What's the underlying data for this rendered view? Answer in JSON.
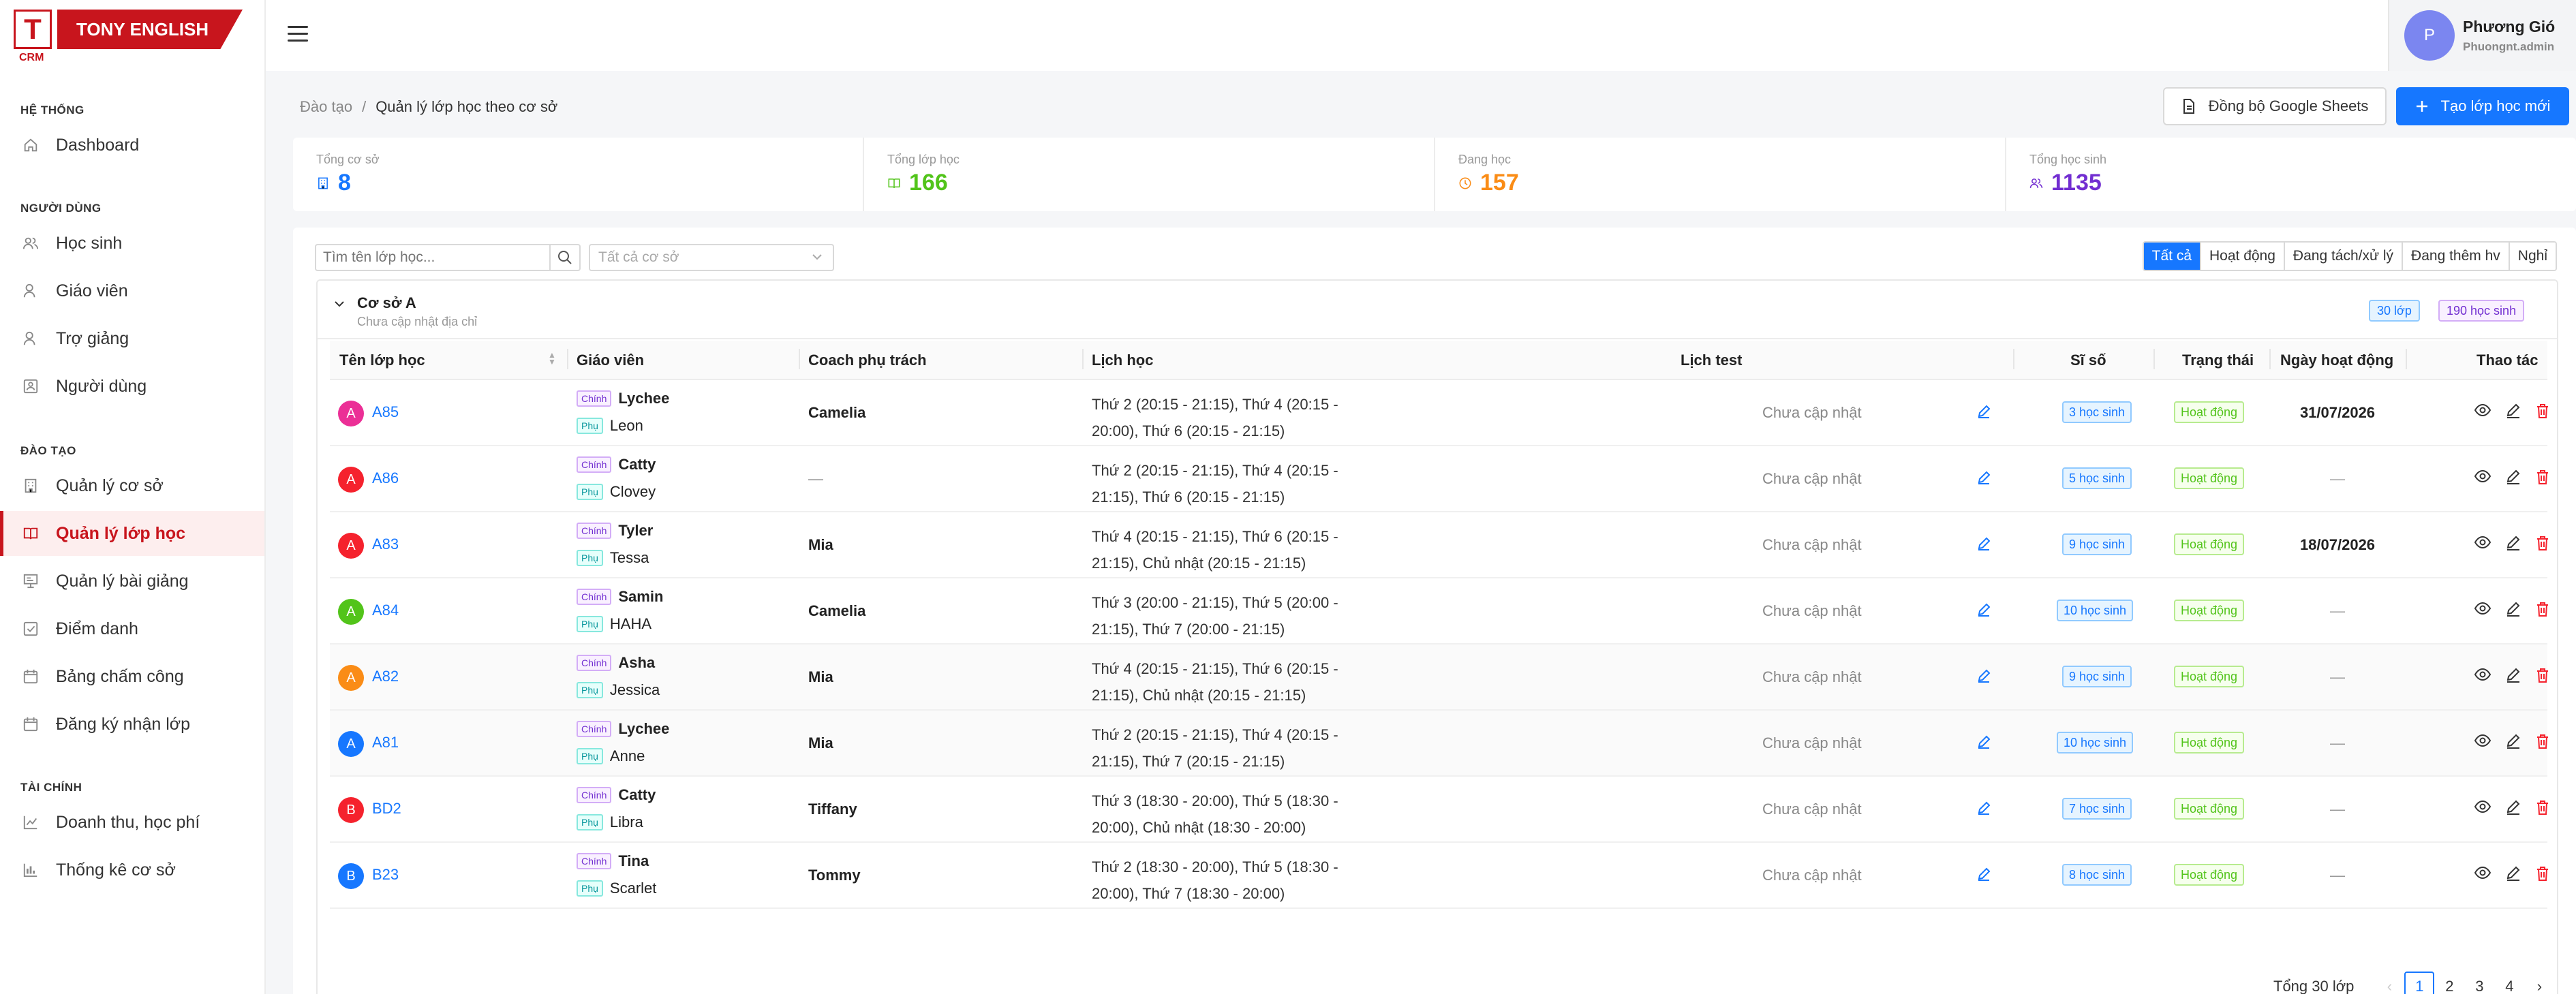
{
  "brand": {
    "letter": "T",
    "name": "TONY ENGLISH",
    "sub": "CRM",
    "color": "#c8151d"
  },
  "sidebar": {
    "sections": [
      {
        "title": "HỆ THỐNG",
        "items": [
          {
            "label": "Dashboard",
            "icon": "home-icon"
          }
        ]
      },
      {
        "title": "NGƯỜI DÙNG",
        "items": [
          {
            "label": "Học sinh",
            "icon": "users-icon"
          },
          {
            "label": "Giáo viên",
            "icon": "user-icon"
          },
          {
            "label": "Trợ giảng",
            "icon": "user-icon"
          },
          {
            "label": "Người dùng",
            "icon": "id-card-icon"
          }
        ]
      },
      {
        "title": "ĐÀO TẠO",
        "items": [
          {
            "label": "Quản lý cơ sở",
            "icon": "building-icon"
          },
          {
            "label": "Quản lý lớp học",
            "icon": "book-icon",
            "active": true
          },
          {
            "label": "Quản lý bài giảng",
            "icon": "presentation-icon"
          },
          {
            "label": "Điểm danh",
            "icon": "checkbox-icon"
          },
          {
            "label": "Bảng chấm công",
            "icon": "calendar-icon"
          },
          {
            "label": "Đăng ký nhận lớp",
            "icon": "calendar-icon"
          }
        ]
      },
      {
        "title": "TÀI CHÍNH",
        "items": [
          {
            "label": "Doanh thu, học phí",
            "icon": "chart-icon"
          },
          {
            "label": "Thống kê cơ sở",
            "icon": "bar-chart-icon"
          }
        ]
      }
    ]
  },
  "user": {
    "avatar_letter": "P",
    "name": "Phương Gió",
    "username": "Phuongnt.admin"
  },
  "breadcrumb": {
    "parent": "Đào tạo",
    "separator": "/",
    "current": "Quản lý lớp học theo cơ sở"
  },
  "actions": {
    "sync_label": "Đồng bộ Google Sheets",
    "create_label": "Tạo lớp học mới"
  },
  "stats": [
    {
      "label": "Tổng cơ sở",
      "value": "8",
      "color": "#1677ff",
      "icon": "building-icon"
    },
    {
      "label": "Tổng lớp học",
      "value": "166",
      "color": "#52c41a",
      "icon": "book-icon"
    },
    {
      "label": "Đang học",
      "value": "157",
      "color": "#fa8c16",
      "icon": "clock-icon"
    },
    {
      "label": "Tổng học sinh",
      "value": "1135",
      "color": "#722ed1",
      "icon": "users-icon"
    }
  ],
  "search": {
    "placeholder": "Tìm tên lớp học..."
  },
  "branch_select": {
    "placeholder": "Tất cả cơ sở"
  },
  "filters": [
    {
      "label": "Tất cả",
      "active": true
    },
    {
      "label": "Hoạt động"
    },
    {
      "label": "Đang tách/xử lý"
    },
    {
      "label": "Đang thêm hv"
    },
    {
      "label": "Nghỉ"
    }
  ],
  "group": {
    "title": "Cơ sở A",
    "subtitle": "Chưa cập nhật địa chỉ",
    "class_count": "30 lớp",
    "student_count": "190 học sinh"
  },
  "columns": {
    "name": "Tên lớp học",
    "teacher": "Giáo viên",
    "coach": "Coach phụ trách",
    "schedule": "Lịch học",
    "test": "Lịch test",
    "size": "Sĩ số",
    "status": "Trạng thái",
    "active_date": "Ngày hoạt động",
    "actions": "Thao tác"
  },
  "roles": {
    "main": "Chính",
    "sub": "Phụ"
  },
  "rows": [
    {
      "letter": "A",
      "color": "#eb2f96",
      "name": "A85",
      "main": "Lychee",
      "sub": "Leon",
      "coach": "Camelia",
      "schedule": "Thứ 2 (20:15 - 21:15), Thứ 4 (20:15 - 20:00), Thứ 6 (20:15 - 21:15)",
      "test": "Chưa cập nhật",
      "size": "3 học sinh",
      "status": "Hoạt động",
      "date": "31/07/2026"
    },
    {
      "letter": "A",
      "color": "#f5222d",
      "name": "A86",
      "main": "Catty",
      "sub": "Clovey",
      "coach": "—",
      "schedule": "Thứ 2 (20:15 - 21:15), Thứ 4 (20:15 - 21:15), Thứ 6 (20:15 - 21:15)",
      "test": "Chưa cập nhật",
      "size": "5 học sinh",
      "status": "Hoạt động",
      "date": "—"
    },
    {
      "letter": "A",
      "color": "#f5222d",
      "name": "A83",
      "main": "Tyler",
      "sub": "Tessa",
      "coach": "Mia",
      "schedule": "Thứ 4 (20:15 - 21:15), Thứ 6 (20:15 - 21:15), Chủ nhật (20:15 - 21:15)",
      "test": "Chưa cập nhật",
      "size": "9 học sinh",
      "status": "Hoạt động",
      "date": "18/07/2026"
    },
    {
      "letter": "A",
      "color": "#52c41a",
      "name": "A84",
      "main": "Samin",
      "sub": "HAHA",
      "coach": "Camelia",
      "schedule": "Thứ 3 (20:00 - 21:15), Thứ 5 (20:00 - 21:15), Thứ 7 (20:00 - 21:15)",
      "test": "Chưa cập nhật",
      "size": "10 học sinh",
      "status": "Hoạt động",
      "date": "—"
    },
    {
      "letter": "A",
      "color": "#fa8c16",
      "name": "A82",
      "main": "Asha",
      "sub": "Jessica",
      "coach": "Mia",
      "schedule": "Thứ 4 (20:15 - 21:15), Thứ 6 (20:15 - 21:15), Chủ nhật (20:15 - 21:15)",
      "test": "Chưa cập nhật",
      "size": "9 học sinh",
      "status": "Hoạt động",
      "date": "—"
    },
    {
      "letter": "A",
      "color": "#1677ff",
      "name": "A81",
      "main": "Lychee",
      "sub": "Anne",
      "coach": "Mia",
      "schedule": "Thứ 2 (20:15 - 21:15), Thứ 4 (20:15 - 21:15), Thứ 7 (20:15 - 21:15)",
      "test": "Chưa cập nhật",
      "size": "10 học sinh",
      "status": "Hoạt động",
      "date": "—"
    },
    {
      "letter": "B",
      "color": "#f5222d",
      "name": "BD2",
      "main": "Catty",
      "sub": "Libra",
      "coach": "Tiffany",
      "schedule": "Thứ 3 (18:30 - 20:00), Thứ 5 (18:30 - 20:00), Chủ nhật (18:30 - 20:00)",
      "test": "Chưa cập nhật",
      "size": "7 học sinh",
      "status": "Hoạt động",
      "date": "—"
    },
    {
      "letter": "B",
      "color": "#1677ff",
      "name": "B23",
      "main": "Tina",
      "sub": "Scarlet",
      "coach": "Tommy",
      "schedule": "Thứ 2 (18:30 - 20:00), Thứ 5 (18:30 - 20:00), Thứ 7 (18:30 - 20:00)",
      "test": "Chưa cập nhật",
      "size": "8 học sinh",
      "status": "Hoạt động",
      "date": "—"
    }
  ],
  "pagination": {
    "total": "Tổng 30 lớp",
    "pages": [
      "1",
      "2",
      "3",
      "4"
    ],
    "current": "1"
  }
}
